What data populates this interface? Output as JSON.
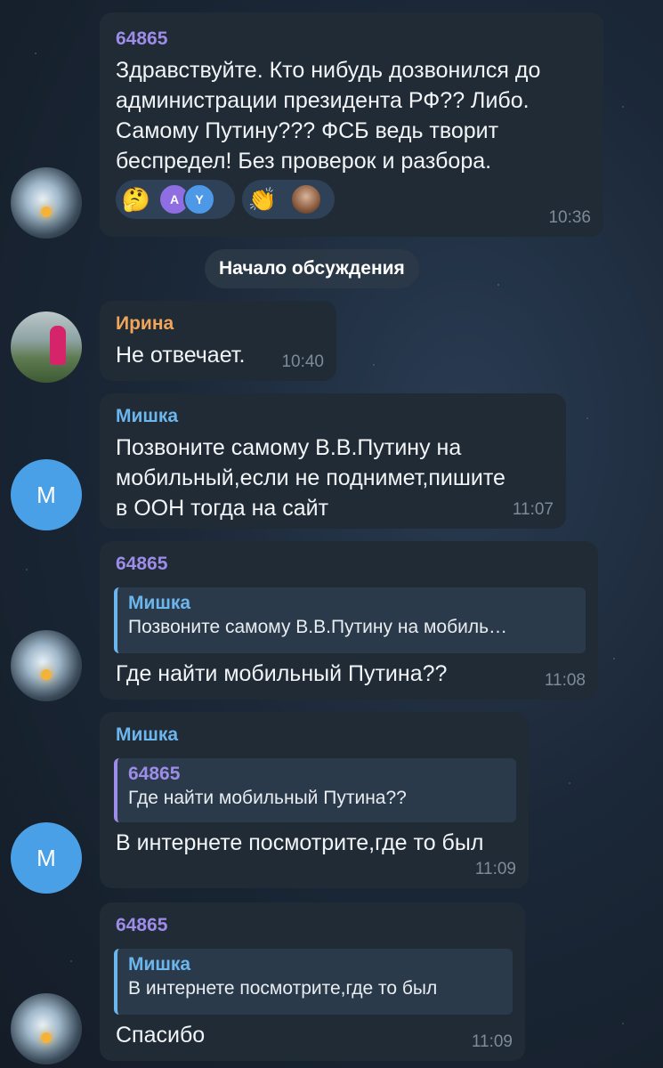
{
  "colors": {
    "name_purple": "#9d8ce8",
    "name_orange": "#f0a55a",
    "name_blue": "#6cb6ee"
  },
  "messages": [
    {
      "sender": "64865",
      "text_lines": [
        "Здравствуйте. Кто нибудь дозвонился до",
        "администрации президента РФ?? Либо.",
        "Самому Путину??? ФСБ ведь творит",
        "беспредел! Без проверок и разбора."
      ],
      "time": "10:36",
      "reactions": [
        {
          "emoji": "🤔",
          "avatars": [
            "A",
            "Y"
          ]
        },
        {
          "emoji": "👏",
          "avatars": [
            "photo"
          ]
        }
      ]
    },
    {
      "sender": "Ирина",
      "text": "Не отвечает.",
      "time": "10:40"
    },
    {
      "sender": "Мишка",
      "avatar_letter": "М",
      "text_lines": [
        "Позвоните самому В.В.Путину на",
        "мобильный,если не поднимет,пишите",
        "в ООН тогда на сайт"
      ],
      "time": "11:07"
    },
    {
      "sender": "64865",
      "reply_to": {
        "name": "Мишка",
        "text": "Позвоните самому В.В.Путину на мобиль…"
      },
      "text": "Где найти мобильный Путина??",
      "time": "11:08"
    },
    {
      "sender": "Мишка",
      "avatar_letter": "М",
      "reply_to": {
        "name": "64865",
        "text": "Где найти мобильный Путина??"
      },
      "text": "В интернете посмотрите,где то был",
      "time": "11:09"
    },
    {
      "sender": "64865",
      "reply_to": {
        "name": "Мишка",
        "text": "В интернете посмотрите,где то был"
      },
      "text": "Спасибо",
      "time": "11:09"
    }
  ],
  "service_message": "Начало обсуждения"
}
